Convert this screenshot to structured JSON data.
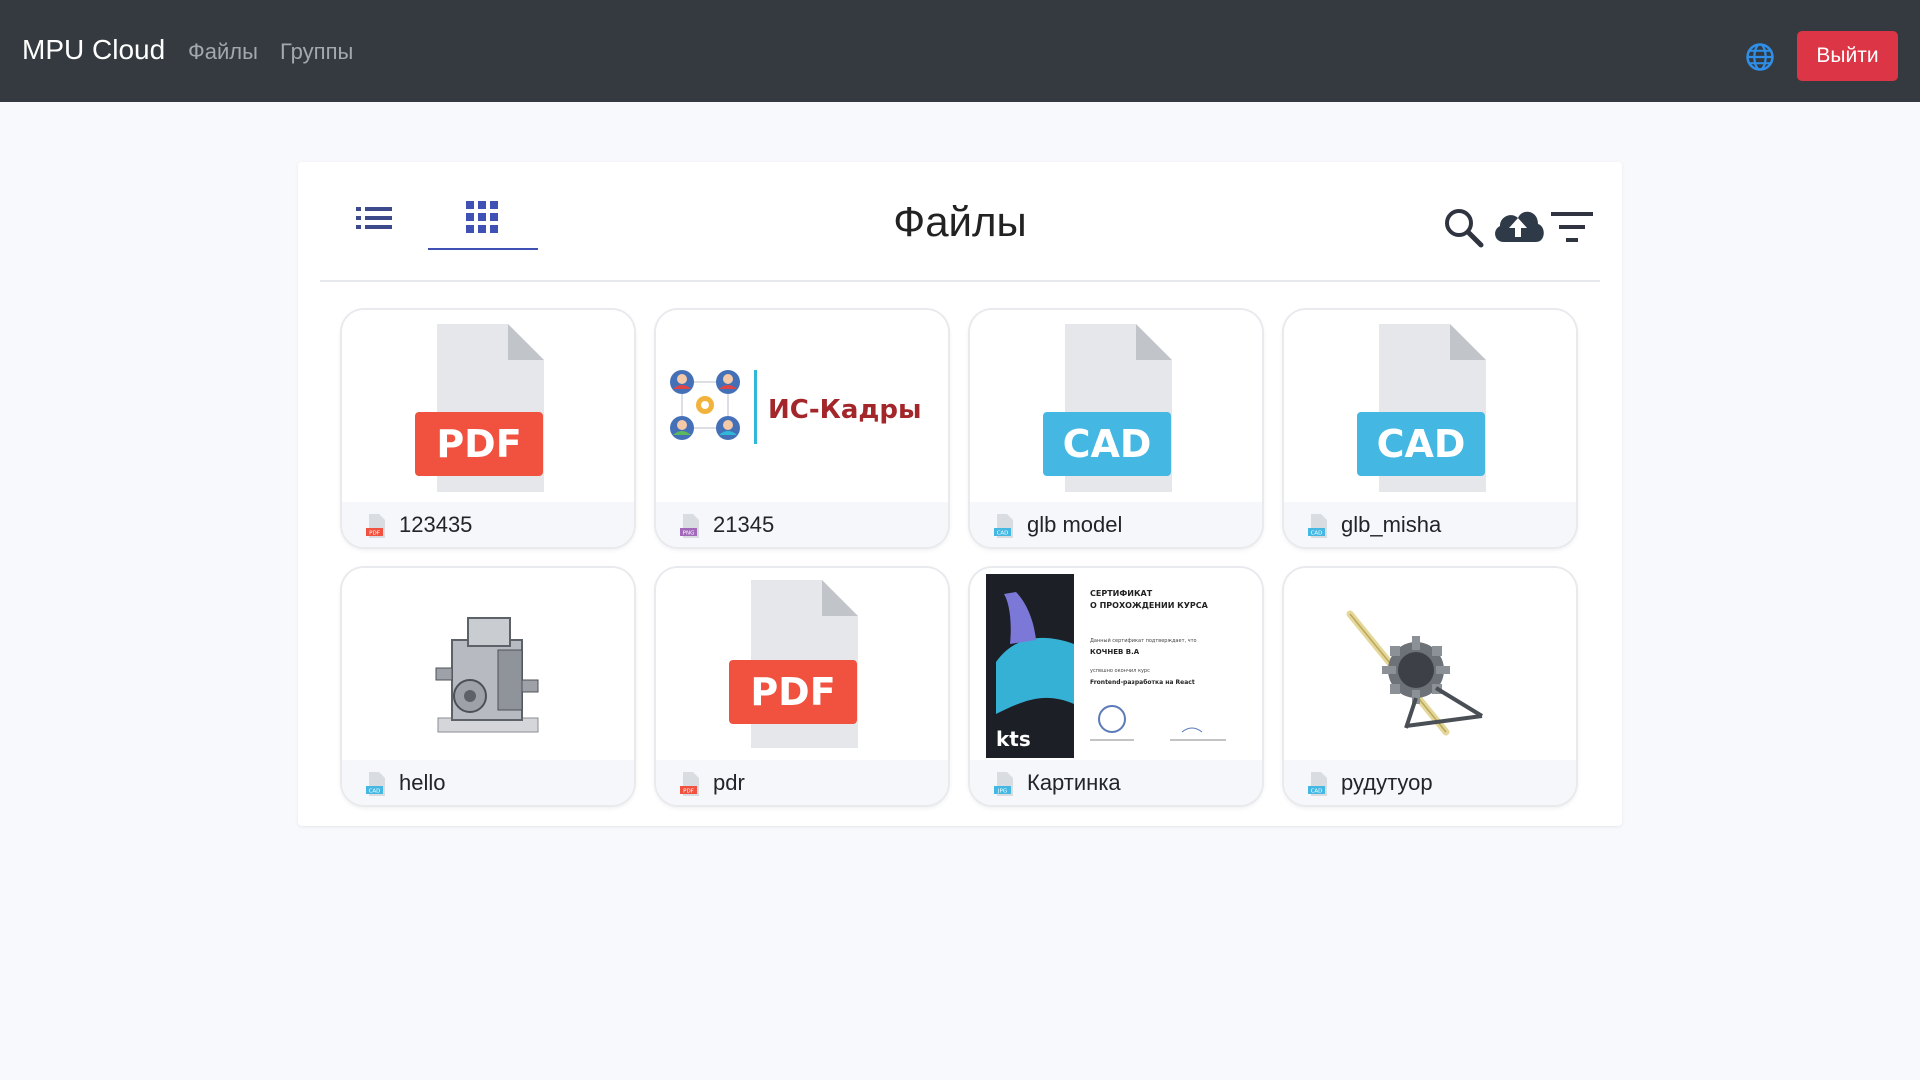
{
  "navbar": {
    "brand": "MPU Cloud",
    "links": [
      "Файлы",
      "Группы"
    ],
    "language_icon": "globe-icon",
    "logout_label": "Выйти",
    "logout_color": "#dc3545",
    "background": "#343a40"
  },
  "main": {
    "title": "Файлы",
    "view_modes": [
      "list-view-icon",
      "grid-view-icon"
    ],
    "active_view": "grid",
    "toolbar_icons": [
      "search-icon",
      "cloud-upload-icon",
      "filter-icon"
    ],
    "accent_color": "#3f51b5"
  },
  "files": [
    {
      "name": "123435",
      "type": "PDF",
      "thumb_label": "PDF",
      "thumb_color": "#f0523f"
    },
    {
      "name": "21345",
      "type": "PNG",
      "thumb_text": "ИС-Кадры",
      "thumb_color": "#a3262a"
    },
    {
      "name": "glb model",
      "type": "CAD",
      "thumb_label": "CAD",
      "thumb_color": "#44b8e3"
    },
    {
      "name": "glb_misha",
      "type": "CAD",
      "thumb_label": "CAD",
      "thumb_color": "#44b8e3"
    },
    {
      "name": "hello",
      "type": "CAD",
      "thumb_color": "#44b8e3"
    },
    {
      "name": "pdr",
      "type": "PDF",
      "thumb_label": "PDF",
      "thumb_color": "#f0523f"
    },
    {
      "name": "Картинка",
      "type": "JPG",
      "certificate": {
        "title_1": "СЕРТИФИКАТ",
        "title_2": "О ПРОХОЖДЕНИИ КУРСА",
        "line_1": "Данный сертификат подтверждает, что",
        "person": "КОЧНЕВ В.А",
        "line_2": "успешно окончил курс",
        "course": "Frontend-разработка на React",
        "brand": "kts"
      },
      "thumb_color": "#44b8e3"
    },
    {
      "name": "рудутуор",
      "type": "CAD",
      "thumb_color": "#44b8e3"
    }
  ]
}
